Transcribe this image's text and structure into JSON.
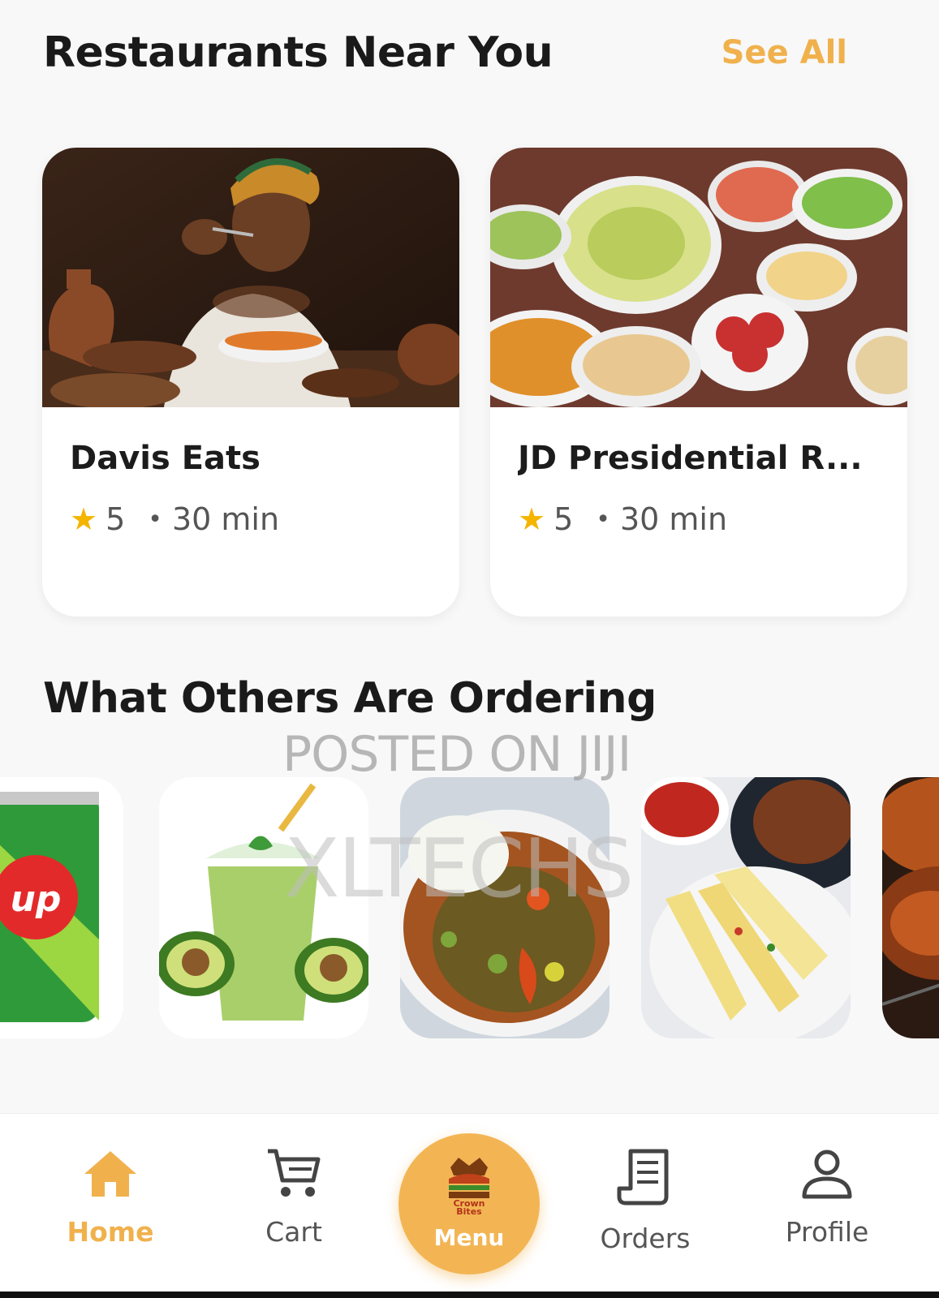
{
  "restaurants_section": {
    "title": "Restaurants Near You",
    "see_all": "See All",
    "cards": [
      {
        "name": "Davis Eats",
        "rating": "5",
        "eta": "30 min"
      },
      {
        "name": "JD Presidential R...",
        "rating": "5",
        "eta": "30 min"
      }
    ]
  },
  "ordering_section": {
    "title": "What Others Are Ordering",
    "items": [
      {
        "image": "7up-can-image"
      },
      {
        "image": "avocado-smoothie-image"
      },
      {
        "image": "fufu-vegetable-soup-image"
      },
      {
        "image": "yam-and-plantain-platter-image"
      },
      {
        "image": "grilled-chicken-image"
      }
    ]
  },
  "watermark": {
    "line1": "POSTED ON JIJI",
    "line2": "XLTECHS"
  },
  "logo_text": "Crown Bites",
  "nav": {
    "home": "Home",
    "cart": "Cart",
    "menu": "Menu",
    "orders": "Orders",
    "profile": "Profile"
  },
  "colors": {
    "accent": "#f0b14d",
    "star": "#f5b400",
    "background": "#f8f8f8"
  }
}
